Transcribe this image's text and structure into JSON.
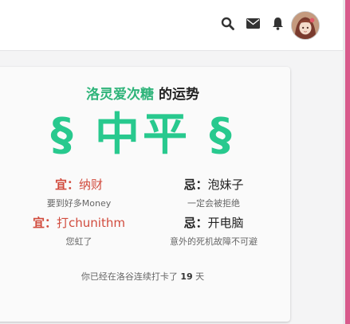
{
  "header": {
    "icons": [
      "search-icon",
      "mail-icon",
      "bell-icon"
    ],
    "avatar": "user-avatar"
  },
  "fortune_card": {
    "title_name": "洛灵爱次糖",
    "title_suffix": " 的运势",
    "fortune": "§ 中平 §",
    "good_label": "宜：",
    "bad_label": "忌：",
    "items": [
      {
        "good": "纳财",
        "good_desc": "要到好多Money",
        "bad": "泡妹子",
        "bad_desc": "一定会被拒绝"
      },
      {
        "good": "打chunithm",
        "good_desc": "您虹了",
        "bad": "开电脑",
        "bad_desc": "意外的死机故障不可避"
      }
    ],
    "streak_prefix": "你已经在洛谷连续打卡了 ",
    "streak_days": "19",
    "streak_suffix": " 天",
    "colors": {
      "accent": "#28c98e",
      "name": "#2fb47a",
      "good": "#d14b3d",
      "side": "#d95a8c"
    }
  }
}
